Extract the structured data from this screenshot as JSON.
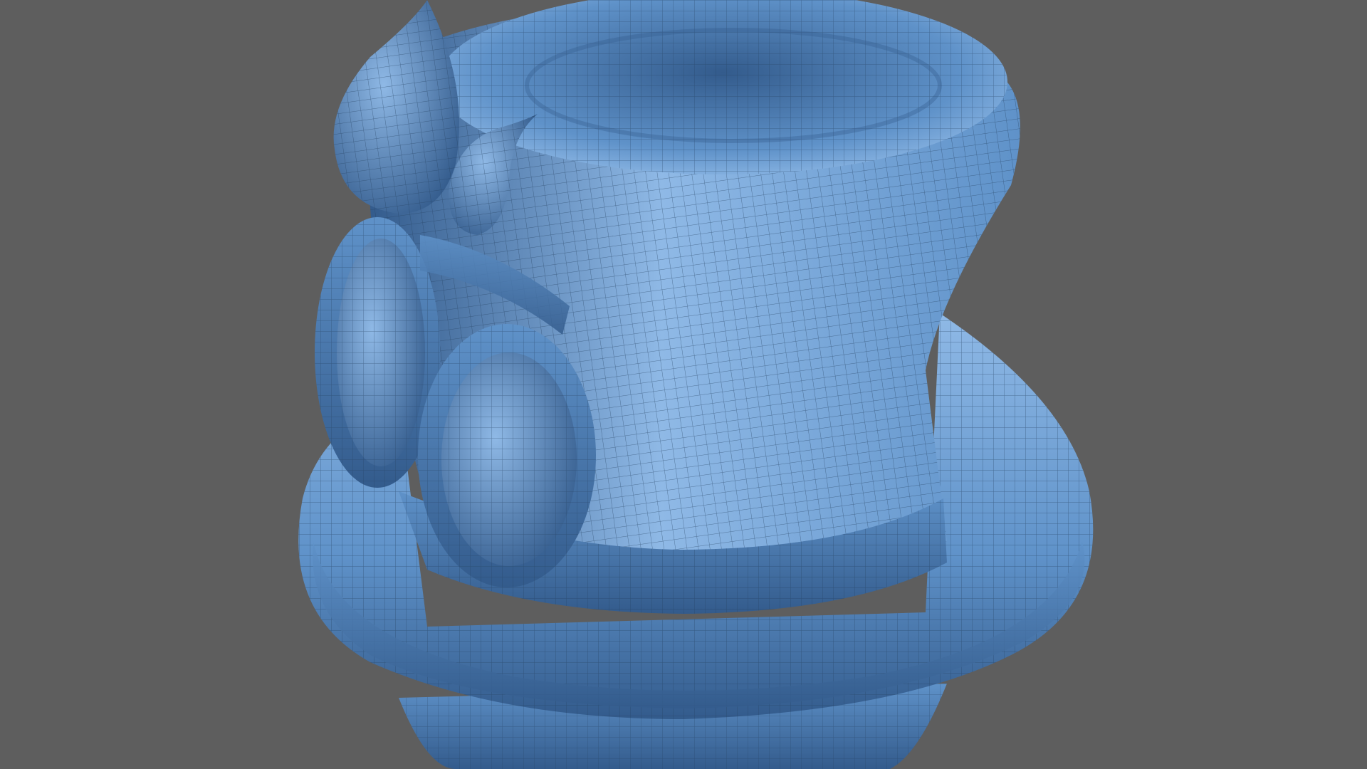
{
  "viewport": {
    "background_color": "#5e5e5e",
    "model": {
      "subject": "top hat",
      "base_color": "#5f92c9",
      "highlight_color": "#8fb9e6",
      "shadow_color": "#335b8c",
      "wireframe_color": "#24405f",
      "wireframe_visible": true
    }
  }
}
